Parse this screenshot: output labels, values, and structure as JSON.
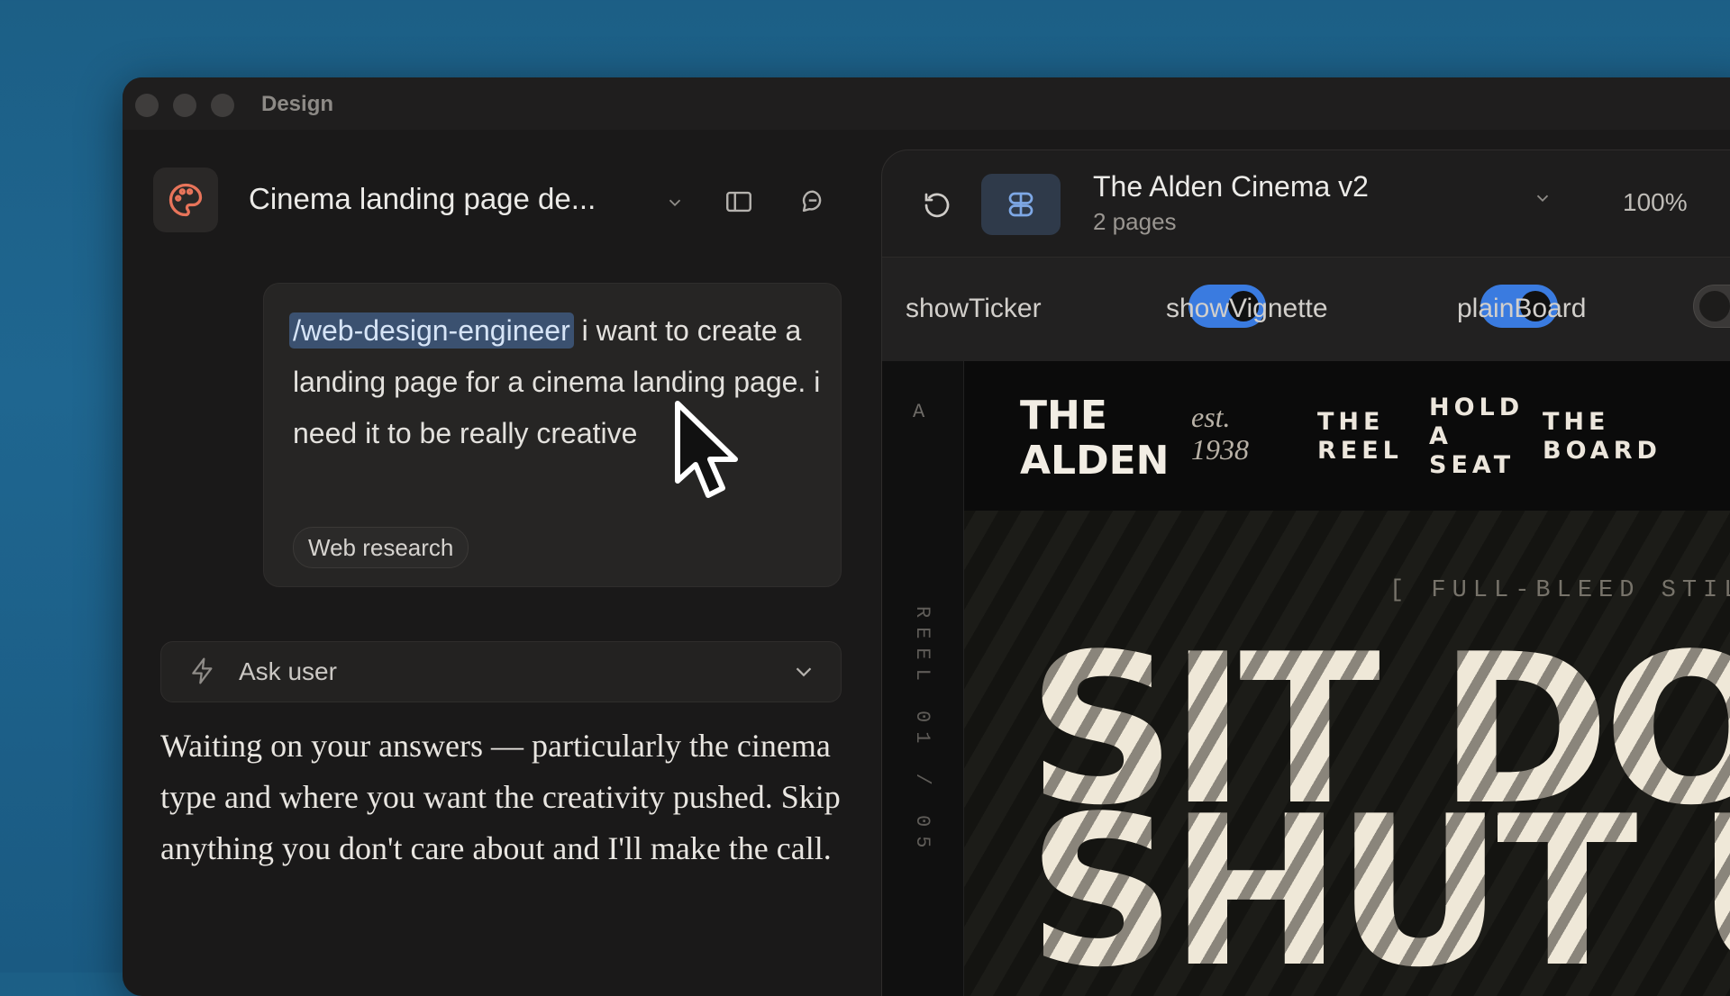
{
  "window": {
    "title": "Design"
  },
  "sidebar": {
    "project_title": "Cinema landing page de...",
    "message": {
      "command": "/web-design-engineer",
      "text": " i want to create a landing page for a cinema landing page. i need it to be really creative",
      "chip": "Web research"
    },
    "ask": {
      "label": "Ask user"
    },
    "waiting_text": "Waiting on your answers — particularly the cinema type and where you want the creativity pushed. Skip anything you don't care about and I'll make the call."
  },
  "preview_panel": {
    "doc_title": "The Alden Cinema v2",
    "doc_sub": "2 pages",
    "zoom": "100%",
    "toggles": [
      {
        "label": "showTicker",
        "on": true
      },
      {
        "label": "showVignette",
        "on": true
      },
      {
        "label": "plainBoard",
        "on": false
      }
    ]
  },
  "site": {
    "gutter_letter": "A",
    "reel_label": "REEL 01 / 05",
    "brand_line1": "THE",
    "brand_line2": "ALDEN",
    "est_line1": "est.",
    "est_line2": "1938",
    "nav": [
      "THE REEL",
      "HOLD A SEAT",
      "THE BOARD"
    ],
    "still_label": "[ FULL-BLEED STILL",
    "hero_line1": "SIT DOW",
    "hero_line2": "SHUT U"
  },
  "colors": {
    "accent": "#3a7be0",
    "highlight": "#3b5170",
    "logo": "#e8745a"
  }
}
